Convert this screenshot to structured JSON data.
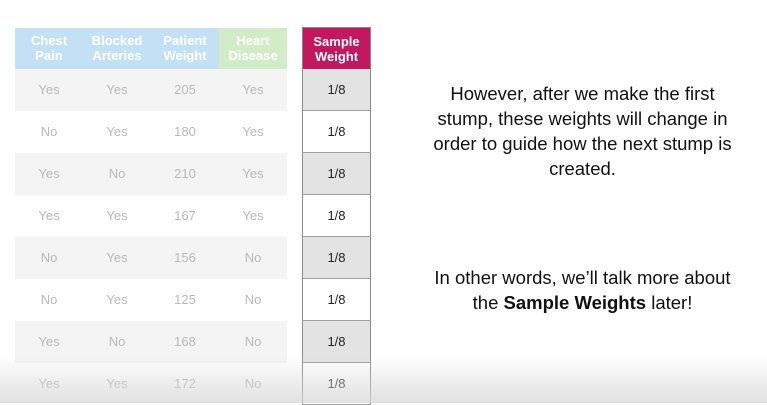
{
  "table": {
    "headers": [
      {
        "line1": "Chest",
        "line2": "Pain"
      },
      {
        "line1": "Blocked",
        "line2": "Arteries"
      },
      {
        "line1": "Patient",
        "line2": "Weight"
      },
      {
        "line1": "Heart",
        "line2": "Disease"
      },
      {
        "line1": "Sample",
        "line2": "Weight"
      }
    ],
    "rows": [
      [
        "Yes",
        "Yes",
        "205",
        "Yes",
        "1/8"
      ],
      [
        "No",
        "Yes",
        "180",
        "Yes",
        "1/8"
      ],
      [
        "Yes",
        "No",
        "210",
        "Yes",
        "1/8"
      ],
      [
        "Yes",
        "Yes",
        "167",
        "Yes",
        "1/8"
      ],
      [
        "No",
        "Yes",
        "156",
        "No",
        "1/8"
      ],
      [
        "No",
        "Yes",
        "125",
        "No",
        "1/8"
      ],
      [
        "Yes",
        "No",
        "168",
        "No",
        "1/8"
      ],
      [
        "Yes",
        "Yes",
        "172",
        "No",
        "1/8"
      ]
    ]
  },
  "text": {
    "paragraph1": "However, after we make the first stump, these weights will change in order to guide how the next stump is created.",
    "paragraph2_before": "In other words, we’ll talk more about the ",
    "paragraph2_bold": "Sample Weights",
    "paragraph2_after": " later!"
  },
  "colors": {
    "header_blue": "#c4e0f5",
    "header_green": "#d2ecc8",
    "sample_header": "#c1185f",
    "faded_text": "#b9b9b9"
  }
}
